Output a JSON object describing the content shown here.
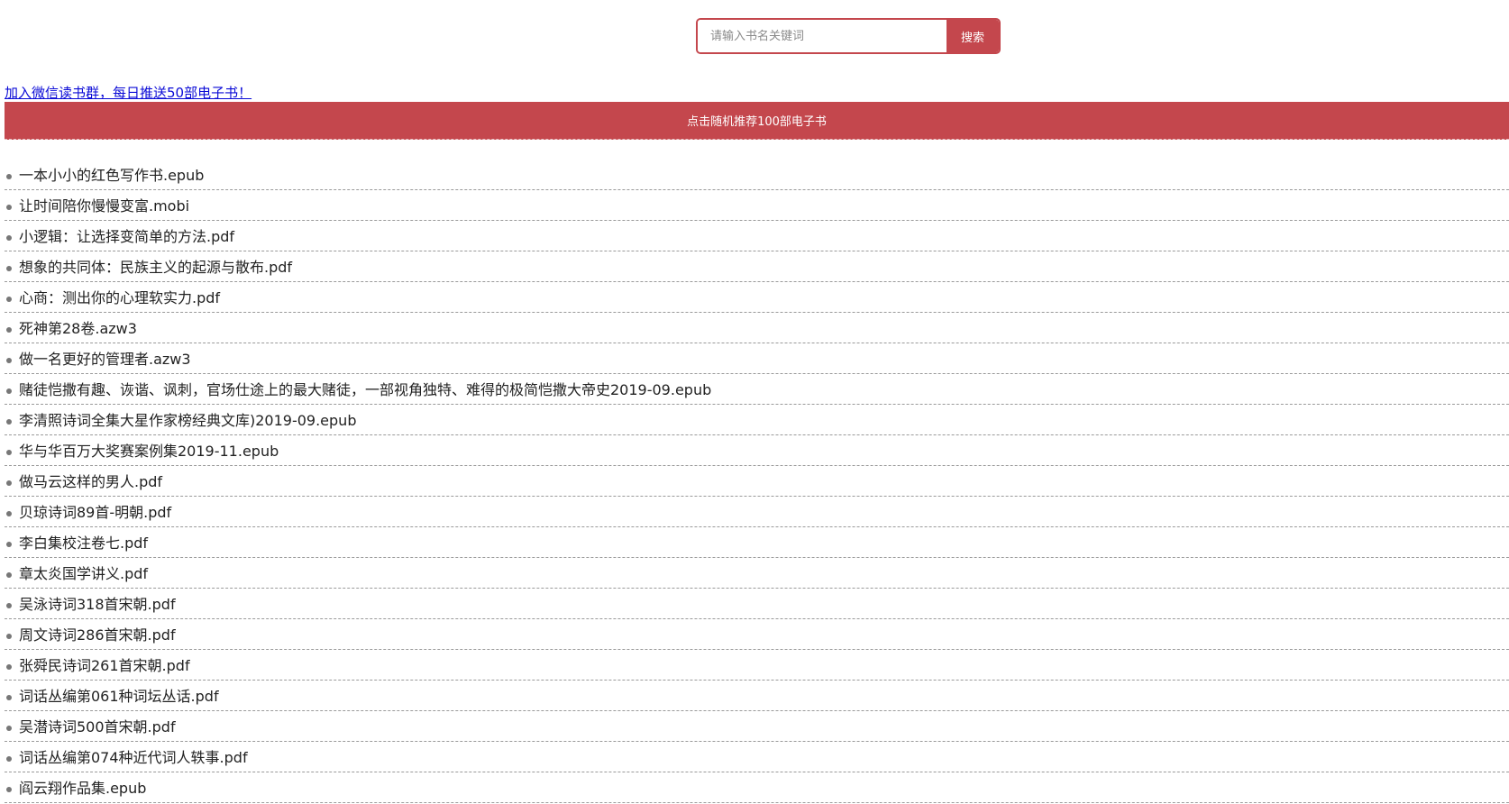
{
  "search": {
    "placeholder": "请输入书名关键词",
    "button_label": "搜索"
  },
  "promo_link": "加入微信读书群，每日推送50部电子书！",
  "random_button": "点击随机推荐100部电子书",
  "books": [
    "一本小小的红色写作书.epub",
    "让时间陪你慢慢变富.mobi",
    "小逻辑：让选择变简单的方法.pdf",
    "想象的共同体：民族主义的起源与散布.pdf",
    "心商：测出你的心理软实力.pdf",
    "死神第28卷.azw3",
    "做一名更好的管理者.azw3",
    "赌徒恺撒有趣、诙谐、讽刺，官场仕途上的最大赌徒，一部视角独特、难得的极简恺撒大帝史2019-09.epub",
    "李清照诗词全集大星作家榜经典文库)2019-09.epub",
    "华与华百万大奖赛案例集2019-11.epub",
    "做马云这样的男人.pdf",
    "贝琼诗词89首-明朝.pdf",
    "李白集校注卷七.pdf",
    "章太炎国学讲义.pdf",
    "吴泳诗词318首宋朝.pdf",
    "周文诗词286首宋朝.pdf",
    "张舜民诗词261首宋朝.pdf",
    "词话丛编第061种词坛丛话.pdf",
    "吴潜诗词500首宋朝.pdf",
    "词话丛编第074种近代词人轶事.pdf",
    "阎云翔作品集.epub"
  ],
  "colors": {
    "accent": "#c4474d",
    "link": "#0a0ad6"
  }
}
